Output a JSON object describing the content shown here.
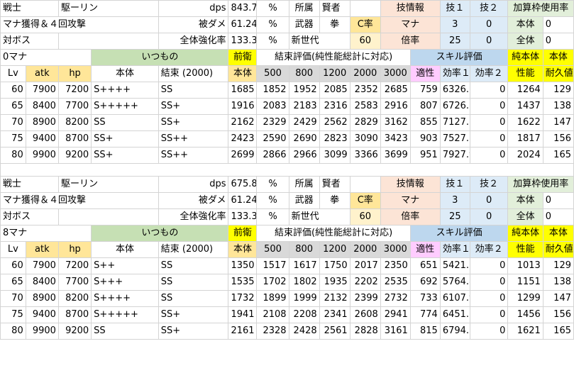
{
  "blocks": [
    {
      "info1": {
        "class": "戦士",
        "name": "駆ーリン",
        "dps_label": "dps",
        "dps": "843.7",
        "pct": "%",
        "affil_label": "所属",
        "affil": "賢者",
        "skill_info": "技情報",
        "skill1": "技１",
        "skill2": "技２",
        "add_label": "加算枠使用率"
      },
      "info2": {
        "desc": "マナ獲得＆４回攻撃",
        "dmg_label": "被ダメ",
        "dmg": "61.24",
        "pct": "%",
        "weapon_label": "武器",
        "weapon": "拳",
        "c_label": "C率",
        "mana_label": "マナ",
        "s1": "3",
        "s2": "0",
        "body_label": "本体",
        "body_val": "0"
      },
      "info3": {
        "target": "対ボス",
        "strength_label": "全体強化率",
        "strength": "133.3",
        "pct": "%",
        "gen_label": "新世代",
        "c_val": "60",
        "mult_label": "倍率",
        "m1": "25",
        "m2": "0",
        "all_label": "全体",
        "all_val": "0"
      },
      "sec": {
        "mana": "0マナ",
        "usual": "いつもの",
        "front": "前衛",
        "bind_eval": "結束評価(純性能総計に対応)",
        "skill_eval": "スキル評価",
        "pure": "純本体",
        "body": "本体"
      },
      "cols": [
        "Lv",
        "atk",
        "hp",
        "本体",
        "結束 (2000)",
        "本体",
        "500",
        "800",
        "1200",
        "2000",
        "3000",
        "適性",
        "効率１",
        "効率２",
        "性能",
        "耐久値"
      ],
      "rows": [
        [
          "60",
          "7900",
          "7200",
          "S++++",
          "SS",
          "1685",
          "1852",
          "1952",
          "2085",
          "2352",
          "2685",
          "759",
          "6326.3",
          "0",
          "1264",
          "129"
        ],
        [
          "65",
          "8400",
          "7700",
          "S+++++",
          "SS+",
          "1916",
          "2083",
          "2183",
          "2316",
          "2583",
          "2916",
          "807",
          "6726.7",
          "0",
          "1437",
          "138"
        ],
        [
          "70",
          "8900",
          "8200",
          "SS",
          "SS+",
          "2162",
          "2329",
          "2429",
          "2562",
          "2829",
          "3162",
          "855",
          "7127.1",
          "0",
          "1622",
          "147"
        ],
        [
          "75",
          "9400",
          "8700",
          "SS+",
          "SS++",
          "2423",
          "2590",
          "2690",
          "2823",
          "3090",
          "3423",
          "903",
          "7527.5",
          "0",
          "1817",
          "156"
        ],
        [
          "80",
          "9900",
          "9200",
          "SS+",
          "SS++",
          "2699",
          "2866",
          "2966",
          "3099",
          "3366",
          "3699",
          "951",
          "7927.9",
          "0",
          "2024",
          "165"
        ]
      ]
    },
    {
      "info1": {
        "class": "戦士",
        "name": "駆ーリン",
        "dps_label": "dps",
        "dps": "675.8",
        "pct": "%",
        "affil_label": "所属",
        "affil": "賢者",
        "skill_info": "技情報",
        "skill1": "技１",
        "skill2": "技２",
        "add_label": "加算枠使用率"
      },
      "info2": {
        "desc": "マナ獲得＆４回攻撃",
        "dmg_label": "被ダメ",
        "dmg": "61.24",
        "pct": "%",
        "weapon_label": "武器",
        "weapon": "拳",
        "c_label": "C率",
        "mana_label": "マナ",
        "s1": "3",
        "s2": "0",
        "body_label": "本体",
        "body_val": "0"
      },
      "info3": {
        "target": "対ボス",
        "strength_label": "全体強化率",
        "strength": "133.3",
        "pct": "%",
        "gen_label": "新世代",
        "c_val": "60",
        "mult_label": "倍率",
        "m1": "25",
        "m2": "0",
        "all_label": "全体",
        "all_val": "0"
      },
      "sec": {
        "mana": "8マナ",
        "usual": "いつもの",
        "front": "前衛",
        "bind_eval": "結束評価(純性能総計に対応)",
        "skill_eval": "スキル評価",
        "pure": "純本体",
        "body": "本体"
      },
      "cols": [
        "Lv",
        "atk",
        "hp",
        "本体",
        "結束 (2000)",
        "本体",
        "500",
        "800",
        "1200",
        "2000",
        "3000",
        "適性",
        "効率１",
        "効率２",
        "性能",
        "耐久値"
      ],
      "rows": [
        [
          "60",
          "7900",
          "7200",
          "S++",
          "SS",
          "1350",
          "1517",
          "1617",
          "1750",
          "2017",
          "2350",
          "651",
          "5421.7",
          "0",
          "1013",
          "129"
        ],
        [
          "65",
          "8400",
          "7700",
          "S+++",
          "SS",
          "1535",
          "1702",
          "1802",
          "1935",
          "2202",
          "2535",
          "692",
          "5764.8",
          "0",
          "1151",
          "138"
        ],
        [
          "70",
          "8900",
          "8200",
          "S++++",
          "SS",
          "1732",
          "1899",
          "1999",
          "2132",
          "2399",
          "2732",
          "733",
          "6107.9",
          "0",
          "1299",
          "147"
        ],
        [
          "75",
          "9400",
          "8700",
          "S+++++",
          "SS+",
          "1941",
          "2108",
          "2208",
          "2341",
          "2608",
          "2941",
          "774",
          "6451.1",
          "0",
          "1456",
          "156"
        ],
        [
          "80",
          "9900",
          "9200",
          "SS",
          "SS+",
          "2161",
          "2328",
          "2428",
          "2561",
          "2828",
          "3161",
          "815",
          "6794.2",
          "0",
          "1621",
          "165"
        ]
      ]
    }
  ]
}
